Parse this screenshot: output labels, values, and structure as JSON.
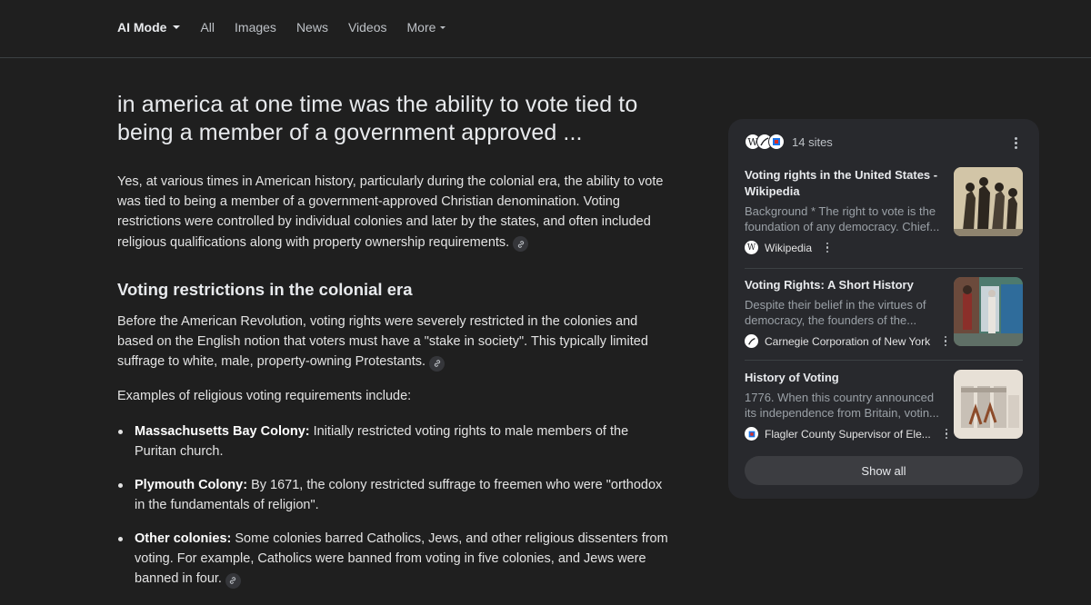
{
  "nav": {
    "items": [
      {
        "label": "AI Mode",
        "active": true,
        "has_caret": true
      },
      {
        "label": "All"
      },
      {
        "label": "Images"
      },
      {
        "label": "News"
      },
      {
        "label": "Videos"
      },
      {
        "label": "More",
        "has_caret": true
      }
    ]
  },
  "main": {
    "query": "in america at one time was the ability to vote tied to being a member of a government approved ...",
    "intro": "Yes, at various times in American history, particularly during the colonial era, the ability to vote was tied to being a member of a government-approved Christian denomination. Voting restrictions were controlled by individual colonies and later by the states, and often included religious qualifications along with property ownership requirements.",
    "section_title": "Voting restrictions in the colonial era",
    "section_para": "Before the American Revolution, voting rights were severely restricted in the colonies and based on the English notion that voters must have a \"stake in society\". This typically limited suffrage to white, male, property-owning Protestants.",
    "examples_intro": "Examples of religious voting requirements include:",
    "bullets": [
      {
        "bold": "Massachusetts Bay Colony:",
        "text": " Initially restricted voting rights to male members of the Puritan church."
      },
      {
        "bold": "Plymouth Colony:",
        "text": " By 1671, the colony restricted suffrage to freemen who were \"orthodox in the fundamentals of religion\"."
      },
      {
        "bold": "Other colonies:",
        "text": " Some colonies barred Catholics, Jews, and other religious dissenters from voting. For example, Catholics were banned from voting in five colonies, and Jews were banned in four."
      }
    ]
  },
  "sources": {
    "count_label": "14 sites",
    "cards": [
      {
        "title": "Voting rights in the United States - Wikipedia",
        "snippet": "Background * The right to vote is the foundation of any democracy. Chief...",
        "source": "Wikipedia",
        "icon": "wikipedia-icon"
      },
      {
        "title": "Voting Rights: A Short History",
        "snippet": "Despite their belief in the virtues of democracy, the founders of the...",
        "source": "Carnegie Corporation of New York",
        "icon": "carnegie-icon"
      },
      {
        "title": "History of Voting",
        "snippet": "1776. When this country announced its independence from Britain, votin...",
        "source": "Flagler County Supervisor of Ele...",
        "icon": "flagler-icon"
      }
    ],
    "show_all_label": "Show all"
  },
  "colors": {
    "background": "#1f1f1f",
    "panel": "#28292d",
    "text": "#e3e3e3",
    "muted": "#9aa0a6"
  }
}
